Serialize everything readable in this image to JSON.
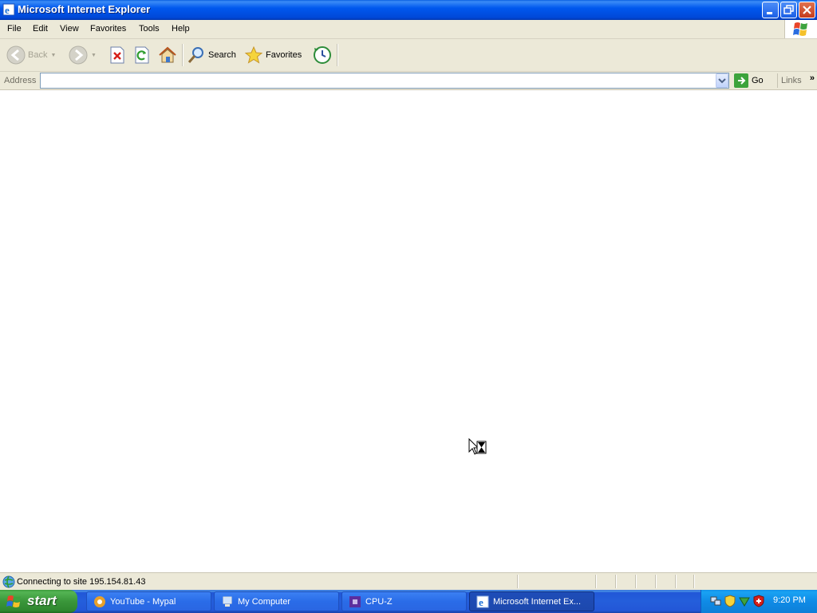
{
  "window": {
    "title": "Microsoft Internet Explorer"
  },
  "menu": {
    "items": [
      "File",
      "Edit",
      "View",
      "Favorites",
      "Tools",
      "Help"
    ]
  },
  "toolbar": {
    "back_label": "Back",
    "search_label": "Search",
    "favorites_label": "Favorites"
  },
  "address_bar": {
    "label": "Address",
    "value": "",
    "go_label": "Go",
    "links_label": "Links"
  },
  "status_bar": {
    "text": "Connecting to site 195.154.81.43"
  },
  "taskbar": {
    "start_label": "start",
    "tasks": [
      {
        "label": "YouTube - Mypal",
        "icon": "mypal-icon"
      },
      {
        "label": "My Computer",
        "icon": "my-computer-icon"
      },
      {
        "label": "CPU-Z",
        "icon": "cpuz-icon"
      },
      {
        "label": "Microsoft Internet Ex...",
        "icon": "ie-icon",
        "active": true
      }
    ],
    "clock": "9:20 PM"
  },
  "colors": {
    "title_bar": "#0058EE",
    "chrome": "#ECE9D8",
    "start_button": "#3a963a",
    "taskbar": "#245edb",
    "tray": "#0f8be6"
  }
}
